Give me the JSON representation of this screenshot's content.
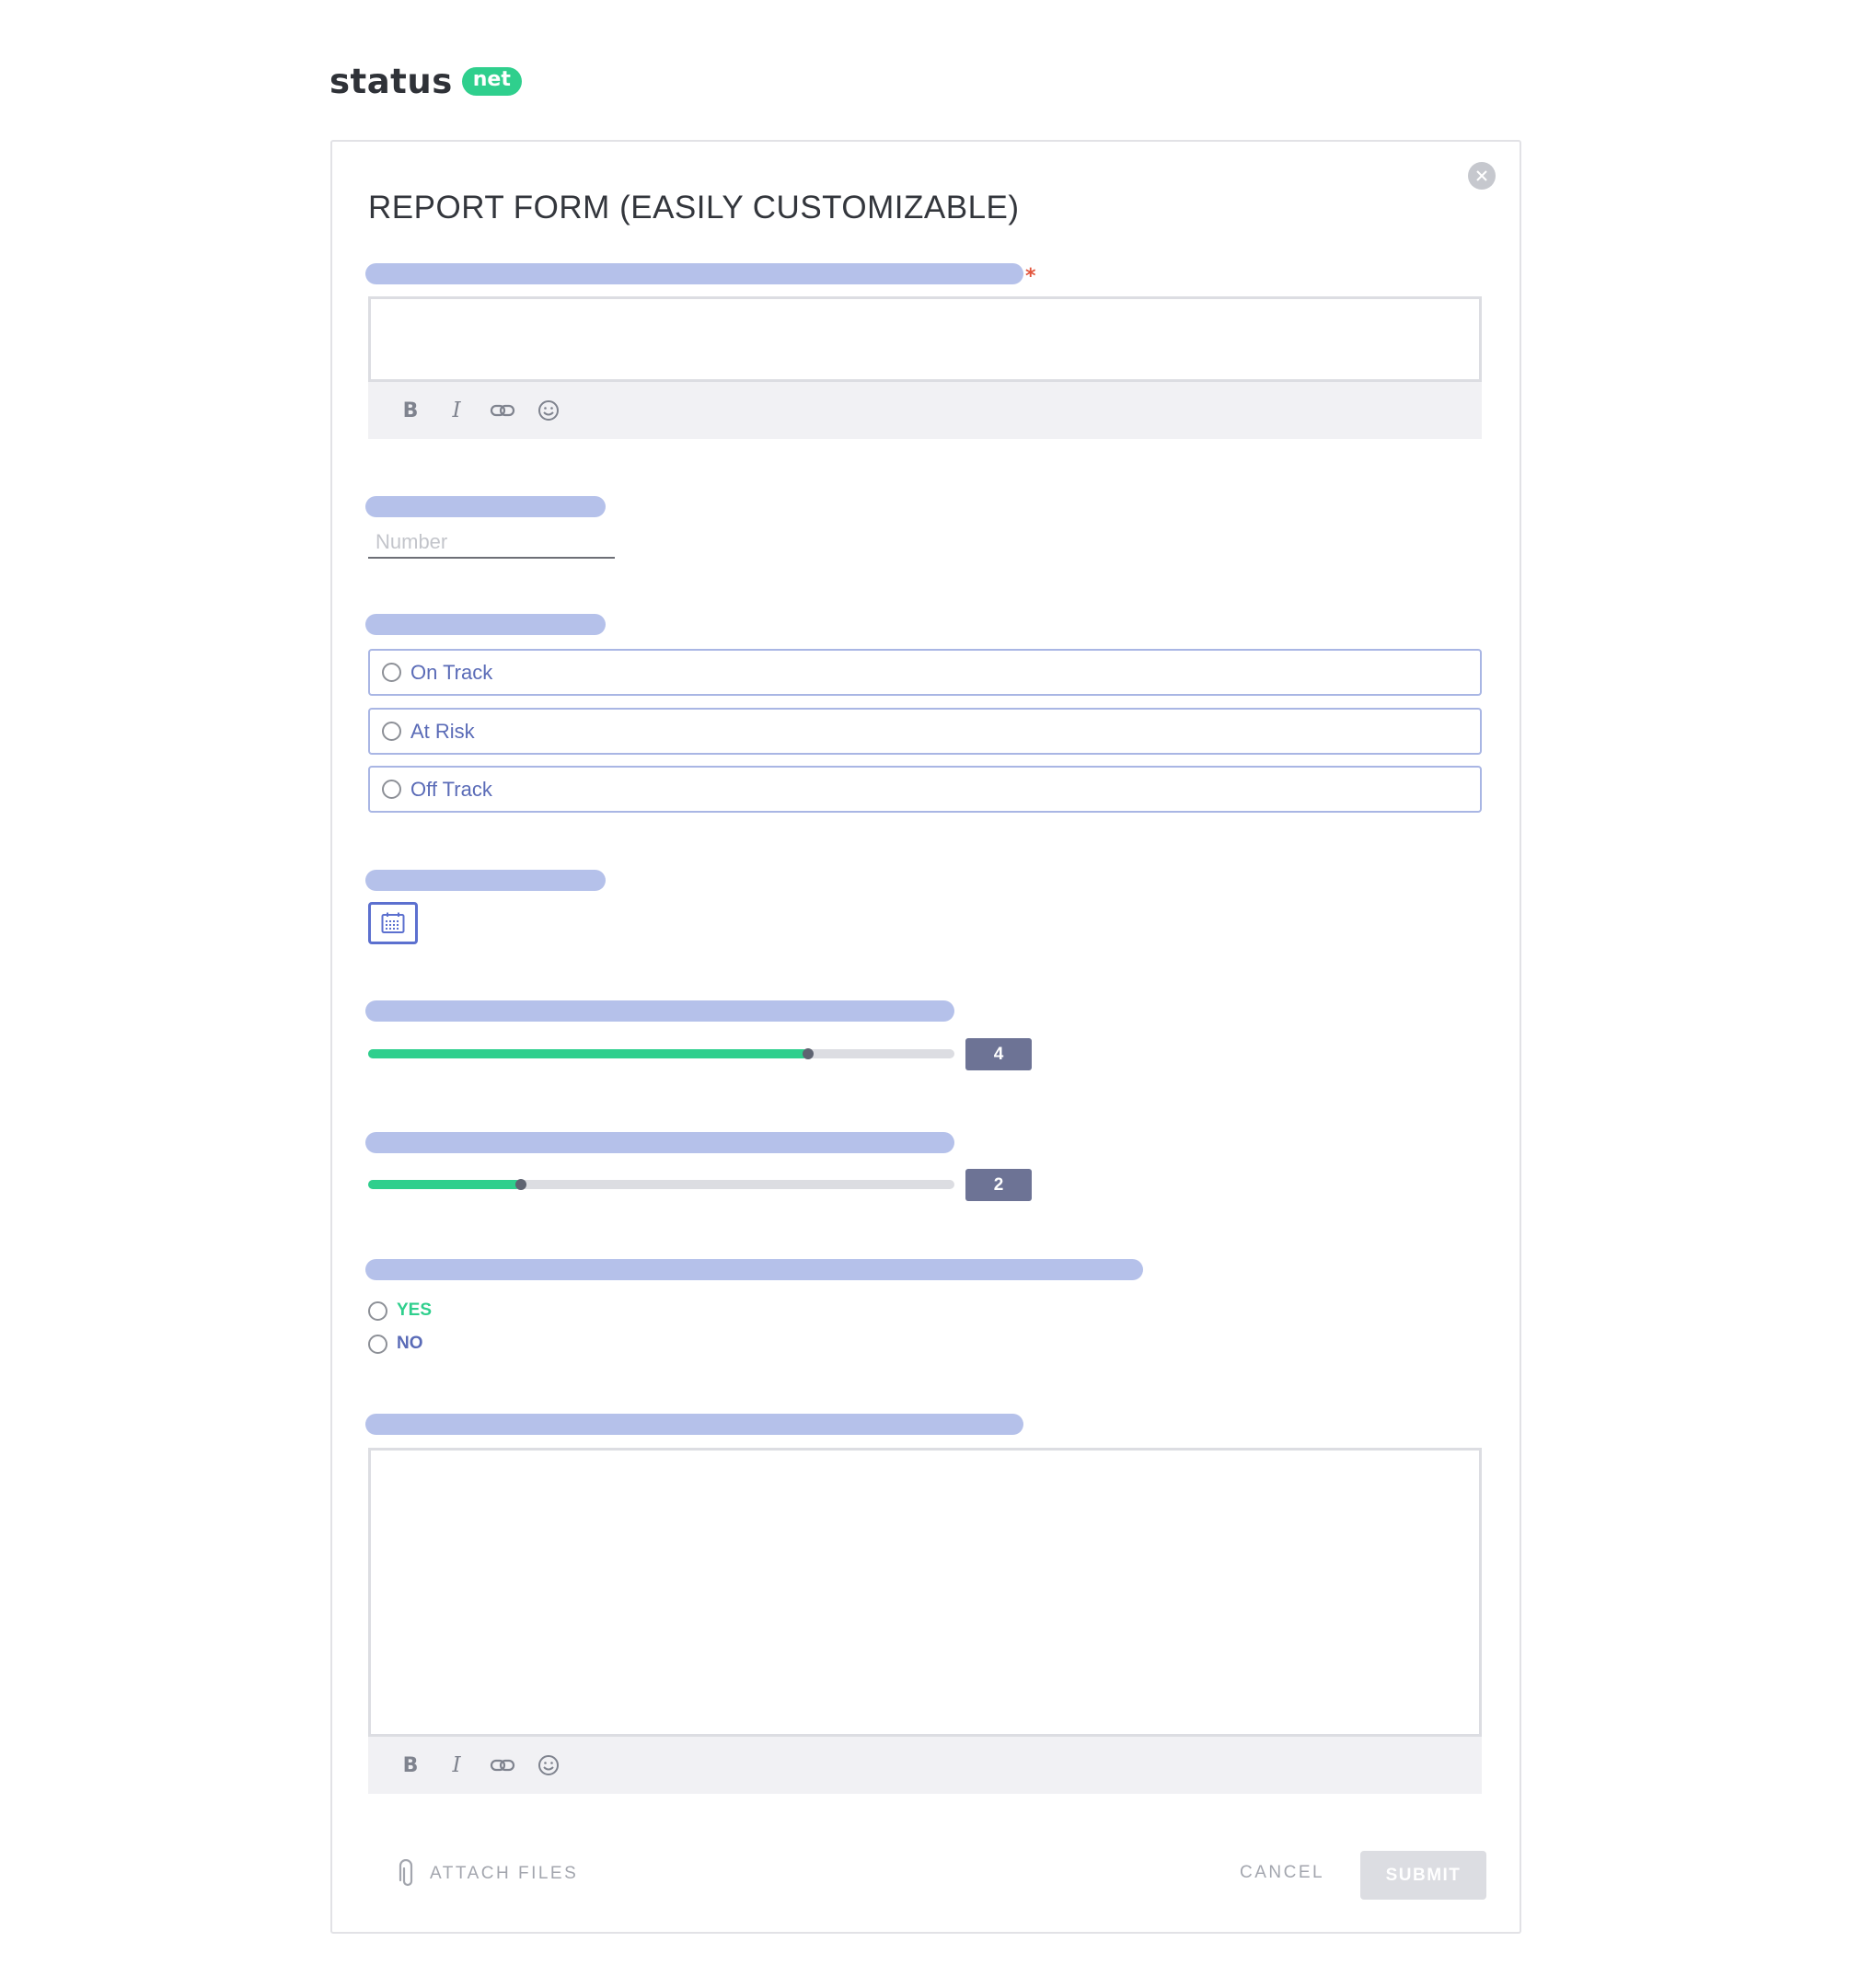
{
  "logo": {
    "word": "status",
    "badge": "net"
  },
  "form": {
    "title": "REPORT FORM (EASILY CUSTOMIZABLE)",
    "required_mark": "*",
    "toolbar": {
      "bold": "B",
      "italic": "I"
    },
    "number_placeholder": "Number",
    "status_options": [
      "On Track",
      "At Risk",
      "Off Track"
    ],
    "slider1": {
      "value": "4",
      "fraction": 0.75
    },
    "slider2": {
      "value": "2",
      "fraction": 0.26
    },
    "yes_label": "YES",
    "no_label": "NO",
    "attach_label": "ATTACH FILES",
    "cancel_label": "CANCEL",
    "submit_label": "SUBMIT"
  },
  "colors": {
    "accent_green": "#2fcf8d",
    "label_placeholder": "#b5c1ea",
    "radio_text": "#5a6bb7",
    "yes_green": "#2fcf8d",
    "no_blue": "#5a6bb7",
    "required_red": "#e2553c"
  },
  "icons": [
    "close-icon",
    "bold-icon",
    "italic-icon",
    "link-icon",
    "emoji-icon",
    "calendar-icon",
    "paperclip-icon"
  ]
}
